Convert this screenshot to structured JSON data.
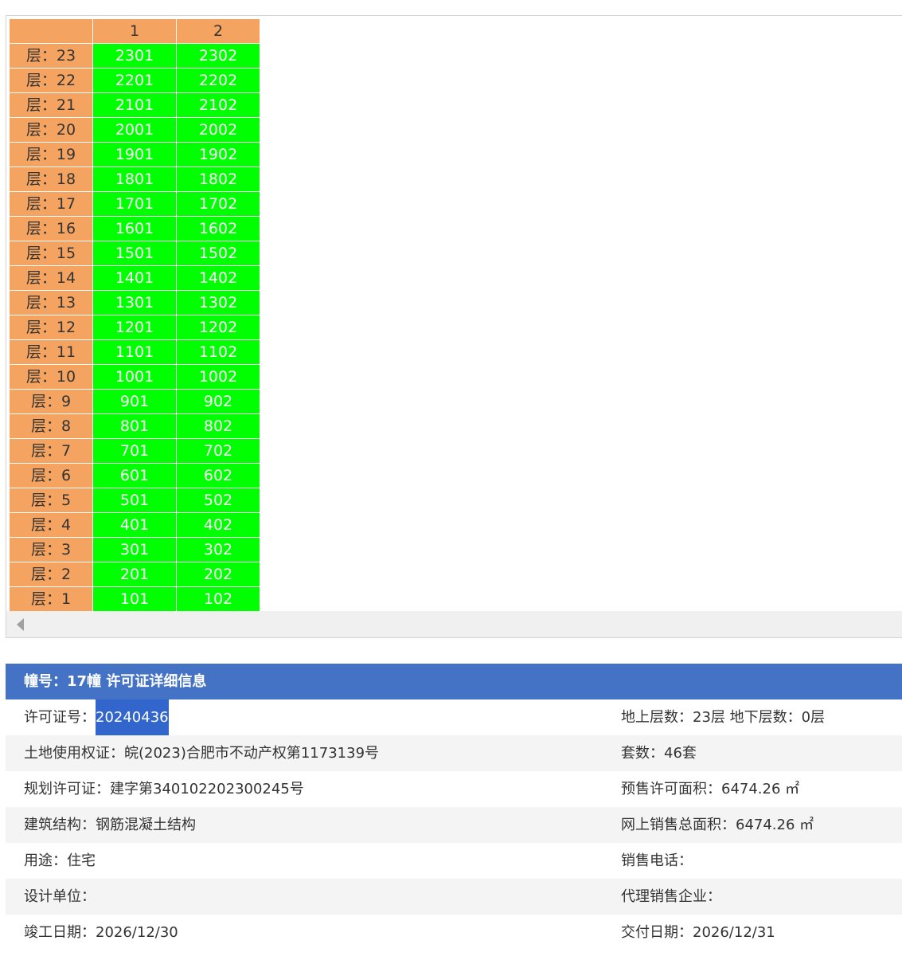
{
  "grid": {
    "corner": "",
    "columns": [
      "1",
      "2"
    ],
    "rows": [
      {
        "floor": "层：23",
        "units": [
          "2301",
          "2302"
        ]
      },
      {
        "floor": "层：22",
        "units": [
          "2201",
          "2202"
        ]
      },
      {
        "floor": "层：21",
        "units": [
          "2101",
          "2102"
        ]
      },
      {
        "floor": "层：20",
        "units": [
          "2001",
          "2002"
        ]
      },
      {
        "floor": "层：19",
        "units": [
          "1901",
          "1902"
        ]
      },
      {
        "floor": "层：18",
        "units": [
          "1801",
          "1802"
        ]
      },
      {
        "floor": "层：17",
        "units": [
          "1701",
          "1702"
        ]
      },
      {
        "floor": "层：16",
        "units": [
          "1601",
          "1602"
        ]
      },
      {
        "floor": "层：15",
        "units": [
          "1501",
          "1502"
        ]
      },
      {
        "floor": "层：14",
        "units": [
          "1401",
          "1402"
        ]
      },
      {
        "floor": "层：13",
        "units": [
          "1301",
          "1302"
        ]
      },
      {
        "floor": "层：12",
        "units": [
          "1201",
          "1202"
        ]
      },
      {
        "floor": "层：11",
        "units": [
          "1101",
          "1102"
        ]
      },
      {
        "floor": "层：10",
        "units": [
          "1001",
          "1002"
        ]
      },
      {
        "floor": "层：9",
        "units": [
          "901",
          "902"
        ]
      },
      {
        "floor": "层：8",
        "units": [
          "801",
          "802"
        ]
      },
      {
        "floor": "层：7",
        "units": [
          "701",
          "702"
        ]
      },
      {
        "floor": "层：6",
        "units": [
          "601",
          "602"
        ]
      },
      {
        "floor": "层：5",
        "units": [
          "501",
          "502"
        ]
      },
      {
        "floor": "层：4",
        "units": [
          "401",
          "402"
        ]
      },
      {
        "floor": "层：3",
        "units": [
          "301",
          "302"
        ]
      },
      {
        "floor": "层：2",
        "units": [
          "201",
          "202"
        ]
      },
      {
        "floor": "层：1",
        "units": [
          "101",
          "102"
        ]
      }
    ]
  },
  "colors": {
    "floor_header": "#f4a460",
    "unit_available": "#00ff00",
    "title_bar": "#4472c4",
    "selection": "#3366cc"
  },
  "icons": {
    "scroll_left": "scroll-left-arrow-icon"
  },
  "info": {
    "title": "幢号：17幢 许可证详细信息",
    "permit_label": "许可证号：",
    "permit_value": "20240436",
    "floors_text": "地上层数：23层  地下层数：0层",
    "land_cert": "土地使用权证：皖(2023)合肥市不动产权第1173139号",
    "units_count": "套数：46套",
    "planning_permit": "规划许可证：建字第340102202300245号",
    "presale_area": "预售许可面积：6474.26 ㎡",
    "structure": "建筑结构：钢筋混凝土结构",
    "online_sales_area": "网上销售总面积：6474.26 ㎡",
    "usage": "用途：住宅",
    "sales_phone": "销售电话：",
    "design_unit": "设计单位：",
    "agent": "代理销售企业：",
    "completion_date": "竣工日期：2026/12/30",
    "delivery_date": "交付日期：2026/12/31"
  }
}
